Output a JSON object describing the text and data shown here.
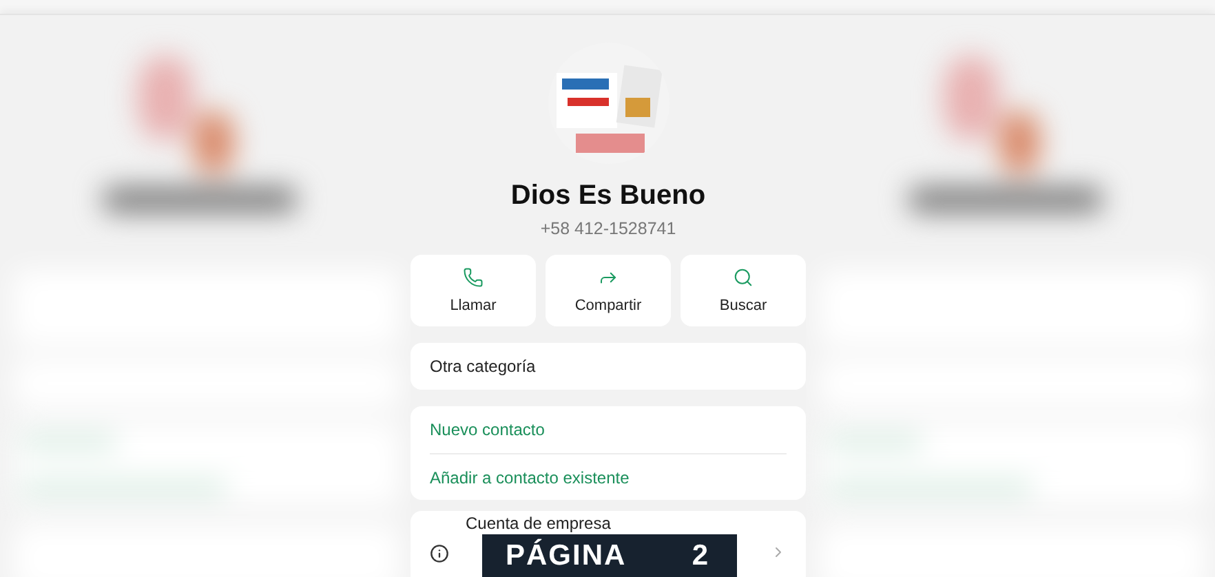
{
  "contact": {
    "name": "Dios Es Bueno",
    "phone": "+58 412-1528741"
  },
  "actions": [
    {
      "kind": "call",
      "label": "Llamar"
    },
    {
      "kind": "share",
      "label": "Compartir"
    },
    {
      "kind": "search",
      "label": "Buscar"
    }
  ],
  "category": "Otra categoría",
  "contact_options": [
    "Nuevo contacto",
    "Añadir a contacto existente"
  ],
  "info_row": {
    "title": "Cuenta de empresa"
  },
  "page_badge": {
    "label": "PÁGINA",
    "number": "2"
  }
}
